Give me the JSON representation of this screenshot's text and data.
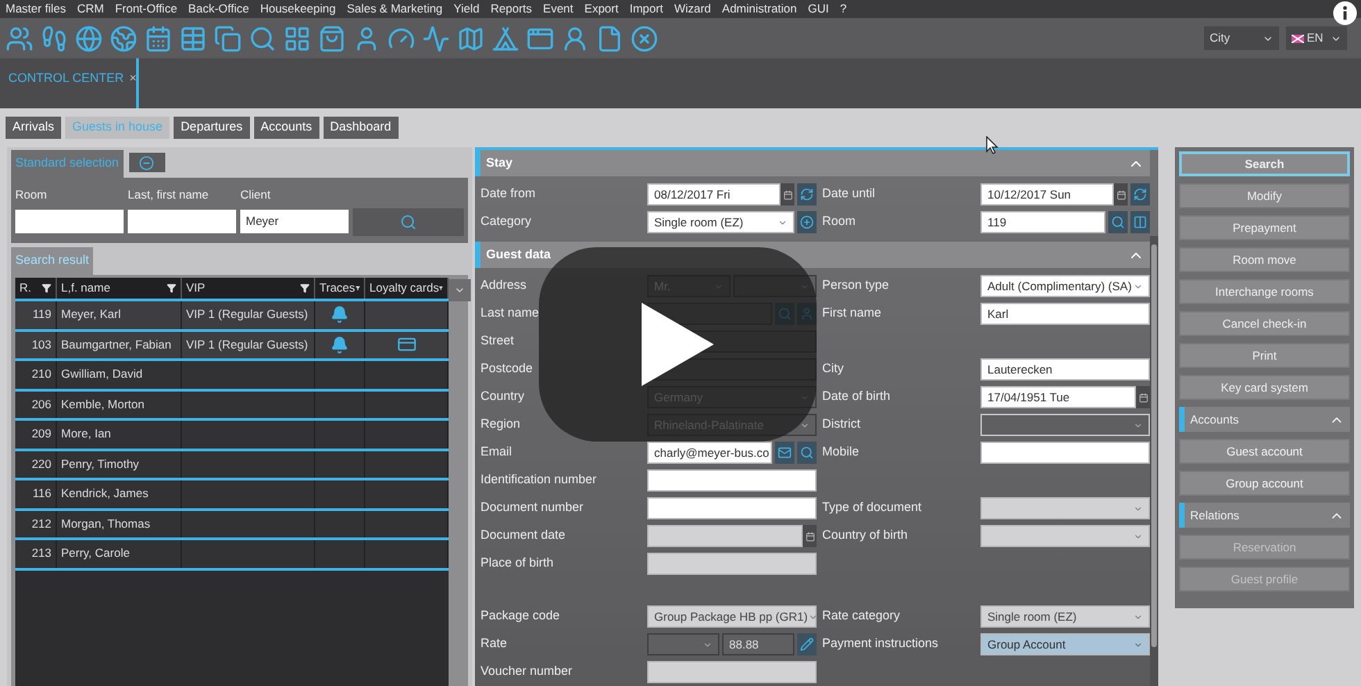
{
  "menu": [
    "Master files",
    "CRM",
    "Front-Office",
    "Back-Office",
    "Housekeeping",
    "Sales & Marketing",
    "Yield",
    "Reports",
    "Event",
    "Export",
    "Import",
    "Wizard",
    "Administration",
    "GUI",
    "?"
  ],
  "toolbar": {
    "city": "City",
    "language": "EN"
  },
  "document_tab": {
    "title": "CONTROL CENTER",
    "close": "×"
  },
  "tabs": [
    {
      "label": "Arrivals",
      "selected": false
    },
    {
      "label": "Guests in house",
      "selected": true
    },
    {
      "label": "Departures",
      "selected": false
    },
    {
      "label": "Accounts",
      "selected": false
    },
    {
      "label": "Dashboard",
      "selected": false
    }
  ],
  "selection": {
    "tab": "Standard selection",
    "fields": [
      {
        "label": "Room"
      },
      {
        "label": "Last, first name"
      },
      {
        "label": "Client",
        "value": "Meyer"
      }
    ]
  },
  "results": {
    "tab": "Search result",
    "columns": [
      "R.",
      "L,f. name",
      "VIP",
      "Traces",
      "Loyalty cards"
    ],
    "rows": [
      {
        "room": "119",
        "name": "Meyer, Karl",
        "vip": "VIP 1 (Regular Guests)",
        "traces": true,
        "loyalty_card": false
      },
      {
        "room": "103",
        "name": "Baumgartner, Fabian",
        "vip": "VIP 1 (Regular Guests)",
        "traces": true,
        "loyalty_card": true
      },
      {
        "room": "210",
        "name": "Gwilliam, David",
        "traces": false,
        "loyalty_card": false
      },
      {
        "room": "206",
        "name": "Kemble, Morton",
        "traces": false,
        "loyalty_card": false
      },
      {
        "room": "209",
        "name": "More, Ian",
        "traces": false,
        "loyalty_card": false
      },
      {
        "room": "220",
        "name": "Penry, Timothy",
        "traces": false,
        "loyalty_card": false
      },
      {
        "room": "116",
        "name": "Kendrick, James",
        "traces": false,
        "loyalty_card": false
      },
      {
        "room": "212",
        "name": "Morgan, Thomas",
        "traces": false,
        "loyalty_card": false
      },
      {
        "room": "213",
        "name": "Perry, Carole",
        "traces": false,
        "loyalty_card": false
      }
    ]
  },
  "stay": {
    "title": "Stay",
    "expanded": true,
    "groups": [
      [
        {
          "left": {
            "label": "Date from",
            "fields": [
              {
                "kind": "date",
                "disabled": false,
                "readonly": false,
                "value": "08/12/2017 Fri"
              }
            ],
            "addons": [
              {
                "kind": "refresh"
              }
            ]
          },
          "right": {
            "label": "Date until",
            "fields": [
              {
                "kind": "date",
                "disabled": false,
                "readonly": false,
                "value": "10/12/2017 Sun"
              }
            ],
            "addons": [
              {
                "kind": "refresh"
              }
            ]
          }
        },
        {
          "left": {
            "label": "Category",
            "fields": [
              {
                "kind": "select",
                "disabled": false,
                "readonly": false,
                "value": "Single room (EZ)"
              }
            ],
            "addons": [
              {
                "kind": "plus"
              }
            ]
          },
          "right": {
            "label": "Room",
            "fields": [
              {
                "kind": "input",
                "disabled": false,
                "readonly": false,
                "value": "119"
              }
            ],
            "addons": [
              {
                "kind": "search"
              },
              {
                "kind": "panel"
              }
            ]
          }
        }
      ]
    ]
  },
  "guest_data": {
    "title": "Guest data",
    "expanded": true,
    "groups": [
      [
        {
          "left": {
            "label": "Address",
            "fields": [
              {
                "kind": "select",
                "disabled": false,
                "readonly": true,
                "value": "Mr."
              },
              {
                "kind": "select",
                "disabled": false,
                "readonly": true
              }
            ]
          },
          "right": {
            "label": "Person type",
            "fields": [
              {
                "kind": "select",
                "disabled": false,
                "readonly": false,
                "value": "Adult (Complimentary) (SA)"
              }
            ]
          }
        },
        {
          "left": {
            "label": "Last name",
            "fields": [
              {
                "kind": "input",
                "disabled": false,
                "readonly": true
              }
            ],
            "addons": [
              {
                "kind": "search"
              },
              {
                "kind": "person"
              }
            ]
          },
          "right": {
            "label": "First name",
            "fields": [
              {
                "kind": "input",
                "disabled": false,
                "readonly": false,
                "value": "Karl"
              }
            ]
          }
        },
        {
          "left": {
            "label": "Street",
            "fields": [
              {
                "kind": "input",
                "disabled": false,
                "readonly": true
              }
            ]
          }
        },
        {
          "left": {
            "label": "Postcode",
            "fields": [
              {
                "kind": "input",
                "disabled": false,
                "readonly": true
              }
            ]
          },
          "right": {
            "label": "City",
            "fields": [
              {
                "kind": "input",
                "disabled": false,
                "readonly": false,
                "value": "Lauterecken"
              }
            ]
          }
        },
        {
          "left": {
            "label": "Country",
            "fields": [
              {
                "kind": "select",
                "disabled": false,
                "readonly": true,
                "value": "Germany"
              }
            ]
          },
          "right": {
            "label": "Date of birth",
            "fields": [
              {
                "kind": "date",
                "disabled": false,
                "readonly": false,
                "value": "17/04/1951 Tue"
              }
            ]
          }
        },
        {
          "left": {
            "label": "Region",
            "fields": [
              {
                "kind": "select",
                "disabled": false,
                "readonly": true,
                "value": "Rhineland-Palatinate"
              }
            ]
          },
          "right": {
            "label": "District",
            "fields": [
              {
                "kind": "select",
                "disabled": false,
                "readonly": true,
                "focused": true
              }
            ]
          }
        },
        {
          "left": {
            "label": "Email",
            "fields": [
              {
                "kind": "input",
                "disabled": false,
                "readonly": false,
                "value": "charly@meyer-bus.co"
              }
            ],
            "addons": [
              {
                "kind": "mail"
              },
              {
                "kind": "search"
              }
            ]
          },
          "right": {
            "label": "Mobile",
            "fields": [
              {
                "kind": "input",
                "disabled": false,
                "readonly": false
              }
            ]
          }
        },
        {
          "left": {
            "label": "Identification number",
            "fields": [
              {
                "kind": "input",
                "disabled": false,
                "readonly": false
              }
            ]
          }
        },
        {
          "left": {
            "label": "Document number",
            "fields": [
              {
                "kind": "input",
                "disabled": false,
                "readonly": false
              }
            ]
          },
          "right": {
            "label": "Type of document",
            "fields": [
              {
                "kind": "select",
                "disabled": true,
                "readonly": false
              }
            ]
          }
        },
        {
          "left": {
            "label": "Document date",
            "fields": [
              {
                "kind": "date",
                "disabled": true,
                "readonly": false
              }
            ]
          },
          "right": {
            "label": "Country of birth",
            "fields": [
              {
                "kind": "select",
                "disabled": true,
                "readonly": false
              }
            ]
          }
        },
        {
          "left": {
            "label": "Place of birth",
            "fields": [
              {
                "kind": "input",
                "disabled": true,
                "readonly": false
              }
            ]
          }
        }
      ],
      [
        {
          "left": {
            "label": "Package code",
            "fields": [
              {
                "kind": "select",
                "disabled": true,
                "readonly": false,
                "value": "Group Package HB pp (GR1)"
              }
            ]
          },
          "right": {
            "label": "Rate category",
            "fields": [
              {
                "kind": "select",
                "disabled": true,
                "readonly": false,
                "value": "Single room (EZ)"
              }
            ]
          }
        },
        {
          "left": {
            "label": "Rate",
            "fields": [
              {
                "kind": "select",
                "disabled": false,
                "readonly": true
              },
              {
                "kind": "input",
                "disabled": false,
                "readonly": true,
                "value": "88.88"
              }
            ],
            "addons": [
              {
                "kind": "pencil"
              }
            ]
          },
          "right": {
            "label": "Payment instructions",
            "fields": [
              {
                "kind": "select",
                "disabled": false,
                "readonly": false,
                "highlighted": true,
                "value": "Group Account"
              }
            ]
          }
        },
        {
          "left": {
            "label": "Voucher number",
            "fields": [
              {
                "kind": "input",
                "disabled": true,
                "readonly": false
              }
            ]
          }
        }
      ]
    ]
  },
  "actions": [
    {
      "label": "Search",
      "selected": true
    },
    {
      "label": "Modify",
      "selected": false
    },
    {
      "label": "Prepayment",
      "selected": false
    },
    {
      "label": "Room move",
      "selected": false
    },
    {
      "label": "Interchange rooms",
      "selected": false
    },
    {
      "label": "Cancel check-in",
      "selected": false
    },
    {
      "label": "Print",
      "selected": false
    },
    {
      "label": "Key card system",
      "selected": false
    }
  ],
  "sections": [
    {
      "title": "Accounts",
      "expanded": true,
      "items": [
        {
          "label": "Guest account",
          "disabled": false
        },
        {
          "label": "Group account",
          "disabled": false
        }
      ]
    },
    {
      "title": "Relations",
      "expanded": true,
      "items": [
        {
          "label": "Reservation",
          "disabled": true
        },
        {
          "label": "Guest profile",
          "disabled": true
        }
      ]
    }
  ]
}
